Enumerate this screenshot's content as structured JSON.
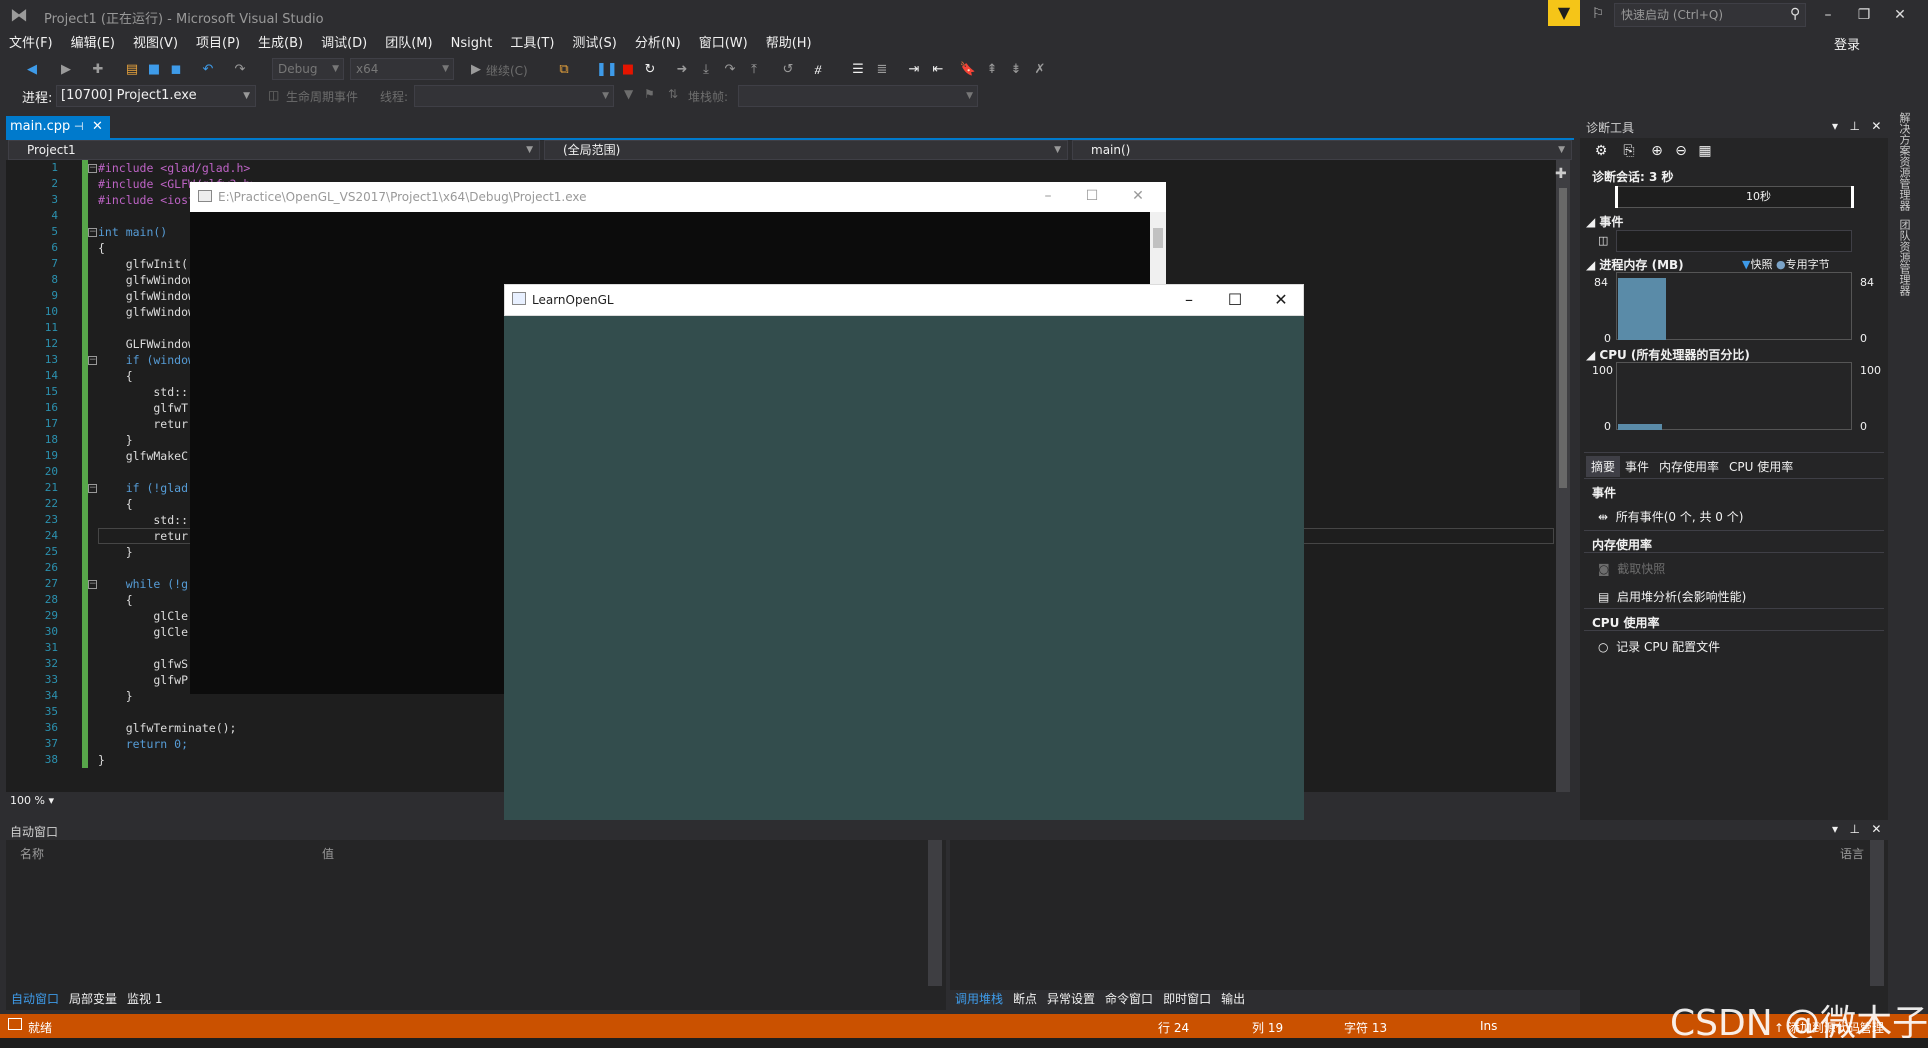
{
  "window": {
    "title": "Project1 (正在运行) - Microsoft Visual Studio",
    "quick_launch_placeholder": "快速启动 (Ctrl+Q)",
    "login": "登录"
  },
  "menu": [
    "文件(F)",
    "编辑(E)",
    "视图(V)",
    "项目(P)",
    "生成(B)",
    "调试(D)",
    "团队(M)",
    "Nsight",
    "工具(T)",
    "测试(S)",
    "分析(N)",
    "窗口(W)",
    "帮助(H)"
  ],
  "toolbar": {
    "config": "Debug",
    "platform": "x64",
    "continue_label": "继续(C)",
    "process_label": "进程:",
    "process_value": "[10700] Project1.exe",
    "lifecycle_label": "生命周期事件",
    "thread_label": "线程:",
    "stackframe_label": "堆栈帧:"
  },
  "editor": {
    "tab_label": "main.cpp",
    "project_combo": "Project1",
    "scope_combo": "(全局范围)",
    "function_combo": "main()",
    "zoom": "100 %",
    "lines": [
      {
        "n": "1",
        "t": "#include <glad/glad.h>"
      },
      {
        "n": "2",
        "t": "#include <GLFW/glfw3.h>"
      },
      {
        "n": "3",
        "t": "#include <iostream>"
      },
      {
        "n": "4",
        "t": ""
      },
      {
        "n": "5",
        "t": "int main()"
      },
      {
        "n": "6",
        "t": "{"
      },
      {
        "n": "7",
        "t": "    glfwInit();"
      },
      {
        "n": "8",
        "t": "    glfwWindowHint"
      },
      {
        "n": "9",
        "t": "    glfwWindowHint"
      },
      {
        "n": "10",
        "t": "    glfwWindowHint"
      },
      {
        "n": "11",
        "t": ""
      },
      {
        "n": "12",
        "t": "    GLFWwindow"
      },
      {
        "n": "13",
        "t": "    if (window"
      },
      {
        "n": "14",
        "t": "    {"
      },
      {
        "n": "15",
        "t": "        std::"
      },
      {
        "n": "16",
        "t": "        glfwT"
      },
      {
        "n": "17",
        "t": "        retur"
      },
      {
        "n": "18",
        "t": "    }"
      },
      {
        "n": "19",
        "t": "    glfwMakeC"
      },
      {
        "n": "20",
        "t": ""
      },
      {
        "n": "21",
        "t": "    if (!glad"
      },
      {
        "n": "22",
        "t": "    {"
      },
      {
        "n": "23",
        "t": "        std::"
      },
      {
        "n": "24",
        "t": "        retur"
      },
      {
        "n": "25",
        "t": "    }"
      },
      {
        "n": "26",
        "t": ""
      },
      {
        "n": "27",
        "t": "    while (!g"
      },
      {
        "n": "28",
        "t": "    {"
      },
      {
        "n": "29",
        "t": "        glCle"
      },
      {
        "n": "30",
        "t": "        glCle"
      },
      {
        "n": "31",
        "t": ""
      },
      {
        "n": "32",
        "t": "        glfwS"
      },
      {
        "n": "33",
        "t": "        glfwP"
      },
      {
        "n": "34",
        "t": "    }"
      },
      {
        "n": "35",
        "t": ""
      },
      {
        "n": "36",
        "t": "    glfwTerminate();"
      },
      {
        "n": "37",
        "t": "    return 0;"
      },
      {
        "n": "38",
        "t": "}"
      }
    ]
  },
  "console_window": {
    "title": "E:\\Practice\\OpenGL_VS2017\\Project1\\x64\\Debug\\Project1.exe"
  },
  "gl_window": {
    "title": "LearnOpenGL",
    "clear_color": "#334d4d"
  },
  "diagnostics": {
    "title": "诊断工具",
    "session": "诊断会话: 3 秒",
    "timeline_label": "10秒",
    "events_header": "事件",
    "memory_header": "进程内存 (MB)",
    "legend_snapshot": "快照",
    "legend_private": "专用字节",
    "memory_max": "84",
    "memory_min": "0",
    "cpu_header": "CPU (所有处理器的百分比)",
    "cpu_max": "100",
    "cpu_min": "0",
    "tabs": [
      "摘要",
      "事件",
      "内存使用率",
      "CPU 使用率"
    ],
    "summary": {
      "events_title": "事件",
      "all_events": "所有事件(0 个, 共 0 个)",
      "memory_title": "内存使用率",
      "take_snapshot": "截取快照",
      "heap_profiling": "启用堆分析(会影响性能)",
      "cpu_title": "CPU 使用率",
      "record_cpu": "记录 CPU 配置文件"
    },
    "side_tabs": [
      "解决方案资源管理器",
      "团队资源管理器"
    ]
  },
  "autos": {
    "title": "自动窗口",
    "col_name": "名称",
    "col_value": "值",
    "tabs": [
      "自动窗口",
      "局部变量",
      "监视 1"
    ]
  },
  "callstack": {
    "col_lang": "语言",
    "tabs": [
      "调用堆栈",
      "断点",
      "异常设置",
      "命令窗口",
      "即时窗口",
      "输出"
    ]
  },
  "statusbar": {
    "ready": "就绪",
    "row": "行 24",
    "col": "列 19",
    "char": "字符 13",
    "ins": "Ins",
    "source_control": "↑ 添加到源代码管理",
    "watermark": "CSDN @微木子"
  }
}
